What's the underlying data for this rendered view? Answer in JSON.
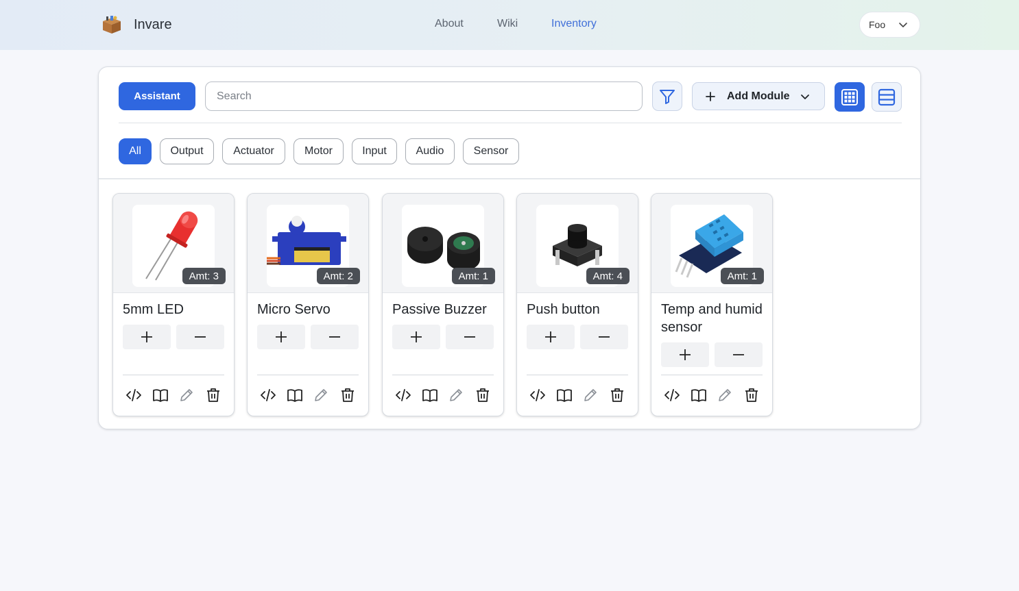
{
  "app": {
    "name": "Invare",
    "logo_icon": "box-icon"
  },
  "nav": {
    "items": [
      {
        "label": "About"
      },
      {
        "label": "Wiki"
      },
      {
        "label": "Inventory",
        "active": true
      }
    ]
  },
  "user": {
    "name": "Foo"
  },
  "toolbar": {
    "assistant_label": "Assistant",
    "search_placeholder": "Search",
    "search_value": "",
    "add_module_label": "Add Module",
    "view_mode": "grid"
  },
  "filters": {
    "active": "All",
    "chips": [
      "All",
      "Output",
      "Actuator",
      "Motor",
      "Input",
      "Audio",
      "Sensor"
    ]
  },
  "modules": [
    {
      "name": "5mm LED",
      "amount": "Amt: 3",
      "image": "led-image"
    },
    {
      "name": "Micro Servo",
      "amount": "Amt: 2",
      "image": "servo-image"
    },
    {
      "name": "Passive Buzzer",
      "amount": "Amt: 1",
      "image": "buzzer-image"
    },
    {
      "name": "Push button",
      "amount": "Amt: 4",
      "image": "push-button-image"
    },
    {
      "name": "Temp and humid sensor",
      "amount": "Amt: 1",
      "image": "dht-sensor-image"
    }
  ],
  "colors": {
    "accent": "#2f67e0",
    "nav_active": "#3f6ed8",
    "badge": "#4b4f55"
  }
}
